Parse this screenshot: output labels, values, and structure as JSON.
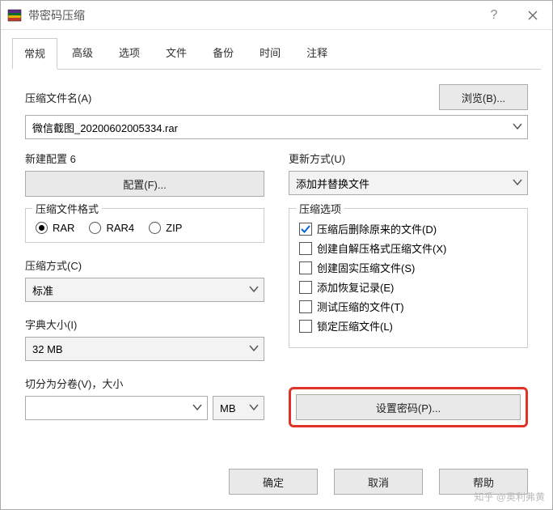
{
  "window": {
    "title": "带密码压缩"
  },
  "tabs": [
    "常规",
    "高级",
    "选项",
    "文件",
    "备份",
    "时间",
    "注释"
  ],
  "general": {
    "browse_label": "浏览(B)...",
    "archive_name_label": "压缩文件名(A)",
    "archive_name_value": "微信截图_20200602005334.rar",
    "profile_label": "新建配置 6",
    "profile_button": "配置(F)...",
    "update_label": "更新方式(U)",
    "update_value": "添加并替换文件",
    "format_legend": "压缩文件格式",
    "formats": [
      {
        "label": "RAR",
        "checked": true
      },
      {
        "label": "RAR4",
        "checked": false
      },
      {
        "label": "ZIP",
        "checked": false
      }
    ],
    "method_label": "压缩方式(C)",
    "method_value": "标准",
    "dict_label": "字典大小(I)",
    "dict_value": "32 MB",
    "split_label": "切分为分卷(V)，大小",
    "split_value": "",
    "split_unit": "MB",
    "options_legend": "压缩选项",
    "options": [
      {
        "label": "压缩后删除原来的文件(D)",
        "checked": true
      },
      {
        "label": "创建自解压格式压缩文件(X)",
        "checked": false
      },
      {
        "label": "创建固实压缩文件(S)",
        "checked": false
      },
      {
        "label": "添加恢复记录(E)",
        "checked": false
      },
      {
        "label": "测试压缩的文件(T)",
        "checked": false
      },
      {
        "label": "锁定压缩文件(L)",
        "checked": false
      }
    ],
    "set_password_label": "设置密码(P)..."
  },
  "footer": {
    "ok": "确定",
    "cancel": "取消",
    "help": "帮助"
  },
  "watermark": "知乎 @奥利弗黄"
}
